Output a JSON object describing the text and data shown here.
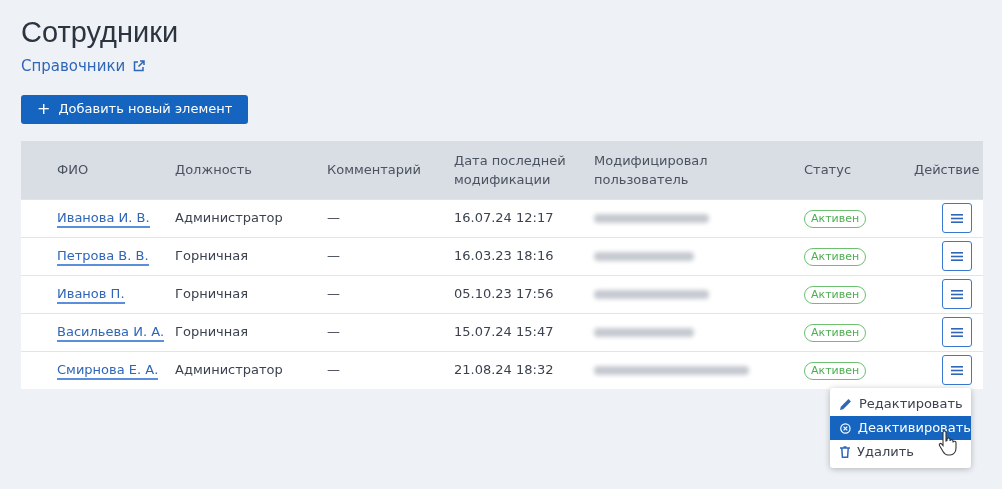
{
  "title": "Сотрудники",
  "breadcrumb_link": "Справочники",
  "add_button": "+",
  "add_button_label": "Добавить новый элемент",
  "table": {
    "columns": [
      "ФИО",
      "Должность",
      "Комментарий",
      "Дата последней модификации",
      "Модифицировал пользователь",
      "Статус",
      "Действие"
    ],
    "rows": [
      {
        "name": "Иванова И. В.",
        "position": "Администратор",
        "comment": "—",
        "modified": "16.07.24 12:17",
        "status": "Активен"
      },
      {
        "name": "Петрова В. В.",
        "position": "Горничная",
        "comment": "—",
        "modified": "16.03.23 18:16",
        "status": "Активен"
      },
      {
        "name": "Иванов П.",
        "position": "Горничная",
        "comment": "—",
        "modified": "05.10.23 17:56",
        "status": "Активен"
      },
      {
        "name": "Васильева И. А.",
        "position": "Горничная",
        "comment": "—",
        "modified": "15.07.24 15:47",
        "status": "Активен"
      },
      {
        "name": "Смирнова Е. А.",
        "position": "Администратор",
        "comment": "—",
        "modified": "21.08.24 18:32",
        "status": "Активен"
      }
    ]
  },
  "action_menu": {
    "items": [
      {
        "kind": "edit",
        "label": "Редактировать",
        "selected": false
      },
      {
        "kind": "deactivate",
        "label": "Деактивировать",
        "selected": true
      },
      {
        "kind": "delete",
        "label": "Удалить",
        "selected": false
      }
    ]
  }
}
